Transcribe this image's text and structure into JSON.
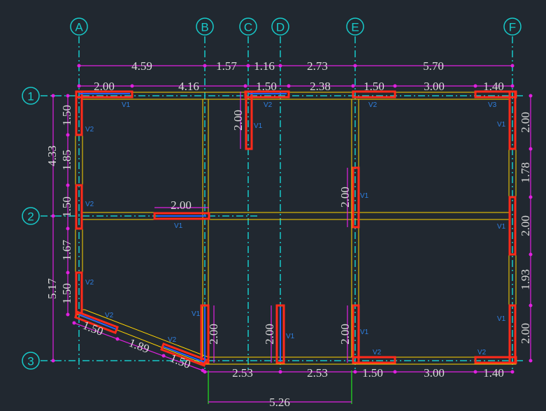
{
  "colors": {
    "background": "#212830",
    "grid": "#17c9c9",
    "dimension": "#e020e0",
    "wall": "#ffd400",
    "opening_red": "#ff2a1a",
    "opening_blue": "#2060ff",
    "dim_text": "#d9d9d9",
    "tag_text": "#2f7fe0",
    "green": "#22c022"
  },
  "axes": {
    "A": "A",
    "B": "B",
    "C": "C",
    "D": "D",
    "E": "E",
    "F": "F",
    "r1": "1",
    "r2": "2",
    "r3": "3"
  },
  "dims": {
    "top1": [
      "4.59",
      "1.57",
      "1.16",
      "2.73",
      "5.70"
    ],
    "top2": [
      "2.00",
      "4.16",
      "1.50",
      "2.38",
      "1.50",
      "3.00",
      "1.40"
    ],
    "left_outer": [
      "4.33",
      "5.17"
    ],
    "left_inner": [
      "1.50",
      "1.85",
      "1.50",
      "1.67",
      "1.50"
    ],
    "right": [
      "2.00",
      "1.78",
      "2.00",
      "1.93",
      "2.00"
    ],
    "bottom": [
      "2.53",
      "2.53",
      "1.50",
      "3.00",
      "1.40"
    ],
    "bottom_total": "5.26",
    "diag": [
      "1.50",
      "1.89",
      "1.50"
    ],
    "inner": {
      "c_opening": "2.00",
      "mid_opening": "2.00",
      "e_opening": "2.00",
      "b_low": "2.00",
      "d_low": "2.00",
      "e_low": "2.00"
    }
  },
  "tags": {
    "v1": "V1",
    "v2": "V2",
    "v3": "V3"
  }
}
